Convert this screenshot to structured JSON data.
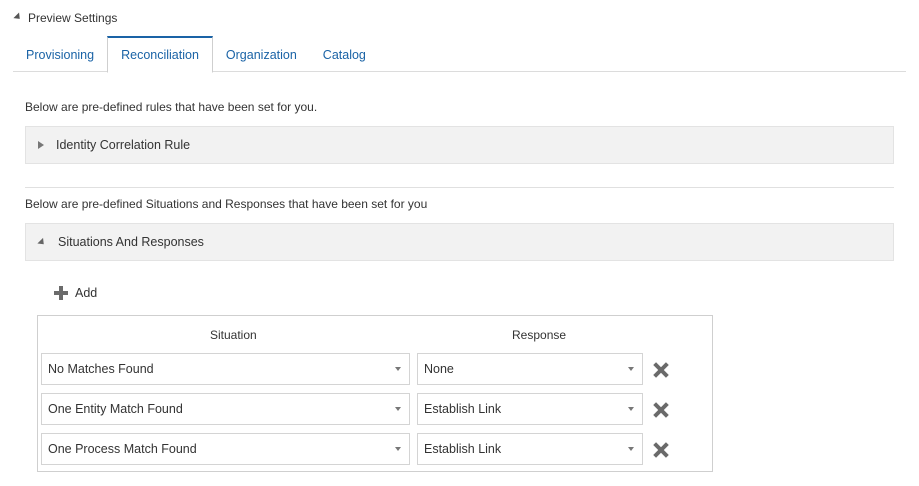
{
  "section": {
    "title": "Preview Settings",
    "icon": "collapse-triangle-icon"
  },
  "tabs": [
    {
      "label": "Provisioning",
      "active": false
    },
    {
      "label": "Reconciliation",
      "active": true
    },
    {
      "label": "Organization",
      "active": false
    },
    {
      "label": "Catalog",
      "active": false
    }
  ],
  "rules": {
    "note": "Below are pre-defined rules that have been set for you.",
    "accordion_label": "Identity Correlation Rule"
  },
  "situations": {
    "note": "Below are pre-defined Situations and Responses that have been set for you",
    "accordion_label": "Situations And Responses",
    "add_label": "Add",
    "columns": {
      "situation": "Situation",
      "response": "Response"
    },
    "rows": [
      {
        "situation": "No Matches Found",
        "response": "None"
      },
      {
        "situation": "One Entity Match Found",
        "response": "Establish Link"
      },
      {
        "situation": "One Process Match Found",
        "response": "Establish Link"
      }
    ]
  },
  "colors": {
    "link": "#1a63a6",
    "accordion_bg": "#f2f2f2",
    "icon_gray": "#6a6a6a"
  }
}
